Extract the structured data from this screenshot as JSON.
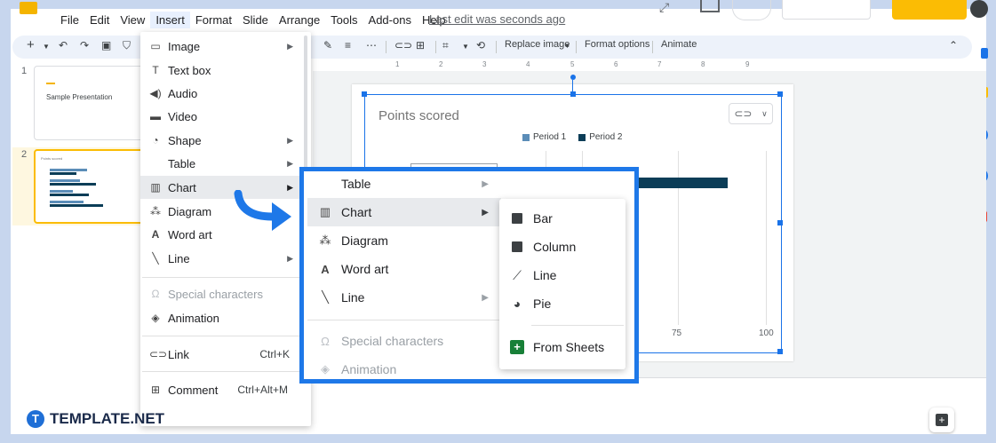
{
  "menubar": {
    "items": [
      "File",
      "Edit",
      "View",
      "Insert",
      "Format",
      "Slide",
      "Arrange",
      "Tools",
      "Add-ons",
      "Help"
    ],
    "last_edit": "Last edit was seconds ago"
  },
  "toolbar": {
    "replace_image": "Replace image",
    "format_options": "Format options",
    "animate": "Animate"
  },
  "ruler": {
    "marks": [
      "1",
      "2",
      "3",
      "4",
      "5",
      "6",
      "7",
      "8",
      "9"
    ]
  },
  "slides_panel": {
    "slides": [
      {
        "number": "1",
        "title": "Sample Presentation"
      },
      {
        "number": "2",
        "title": "Points scored"
      }
    ]
  },
  "chart": {
    "title": "Points scored",
    "legend": [
      "Period 1",
      "Period 2"
    ],
    "colors": {
      "period1": "#5b8db8",
      "period2": "#0b3d57"
    },
    "axis_ticks": [
      "75",
      "100"
    ]
  },
  "insert_menu": {
    "items": [
      {
        "icon": "image-icon",
        "label": "Image",
        "submenu": true
      },
      {
        "icon": "text-box-icon",
        "label": "Text box"
      },
      {
        "icon": "audio-icon",
        "label": "Audio"
      },
      {
        "icon": "video-icon",
        "label": "Video"
      },
      {
        "icon": "shape-icon",
        "label": "Shape",
        "submenu": true
      },
      {
        "icon": "",
        "label": "Table",
        "submenu": true
      },
      {
        "icon": "chart-icon",
        "label": "Chart",
        "submenu": true,
        "highlighted": true
      },
      {
        "icon": "diagram-icon",
        "label": "Diagram"
      },
      {
        "icon": "word-art-icon",
        "label": "Word art"
      },
      {
        "icon": "line-icon",
        "label": "Line",
        "submenu": true
      },
      {
        "icon": "special-characters-icon",
        "label": "Special characters",
        "disabled": true
      },
      {
        "icon": "animation-icon",
        "label": "Animation"
      },
      {
        "icon": "link-icon",
        "label": "Link",
        "shortcut": "Ctrl+K"
      },
      {
        "icon": "comment-icon",
        "label": "Comment",
        "shortcut": "Ctrl+Alt+M"
      }
    ]
  },
  "zoom_menu": {
    "items": [
      {
        "label": "Table"
      },
      {
        "label": "Chart"
      },
      {
        "label": "Diagram"
      },
      {
        "label": "Word art"
      },
      {
        "label": "Line"
      },
      {
        "label": "Special characters"
      },
      {
        "label": "Animation"
      }
    ]
  },
  "chart_submenu": {
    "items": [
      {
        "icon": "bar-chart-icon",
        "label": "Bar"
      },
      {
        "icon": "column-chart-icon",
        "label": "Column"
      },
      {
        "icon": "line-chart-icon",
        "label": "Line"
      },
      {
        "icon": "pie-chart-icon",
        "label": "Pie"
      },
      {
        "icon": "sheets-icon",
        "label": "From Sheets"
      }
    ]
  },
  "branding": {
    "name": "TEMPLATE.NET",
    "initial": "T"
  },
  "colors": {
    "accent_blue": "#1e78e8",
    "frame": "#c7d6ee",
    "share_yellow": "#fbbc04",
    "menu_highlight": "#e8eaed"
  }
}
